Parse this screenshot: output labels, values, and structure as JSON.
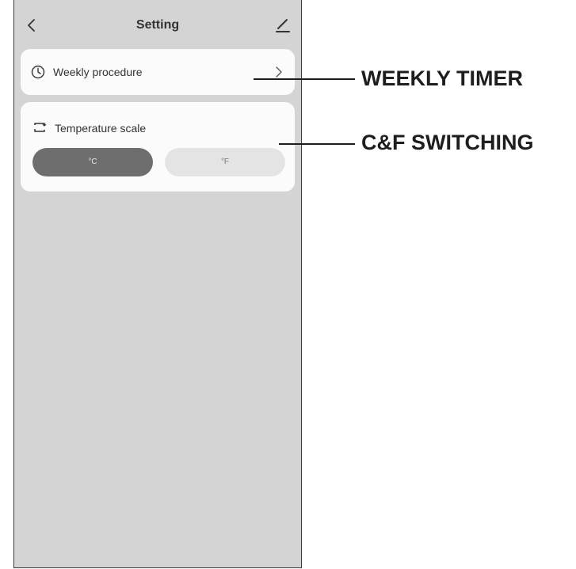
{
  "header": {
    "title": "Setting",
    "back_icon": "chevron-left-icon",
    "edit_icon": "pencil-icon"
  },
  "weekly_card": {
    "icon": "clock-icon",
    "label": "Weekly procedure",
    "chevron_icon": "chevron-right-icon"
  },
  "temperature_card": {
    "icon": "swap-icon",
    "label": "Temperature scale",
    "options": [
      {
        "label": "°C",
        "selected": true
      },
      {
        "label": "°F",
        "selected": false
      }
    ]
  },
  "callouts": {
    "weekly_timer": "WEEKLY TIMER",
    "cf_switching": "C&F SWITCHING"
  },
  "colors": {
    "screen_background": "#d4d4d4",
    "card_background": "#fbfbfb",
    "selected_segment": "#6e6e6e",
    "unselected_segment": "#e4e4e4",
    "callout": "#1e1e1e"
  }
}
